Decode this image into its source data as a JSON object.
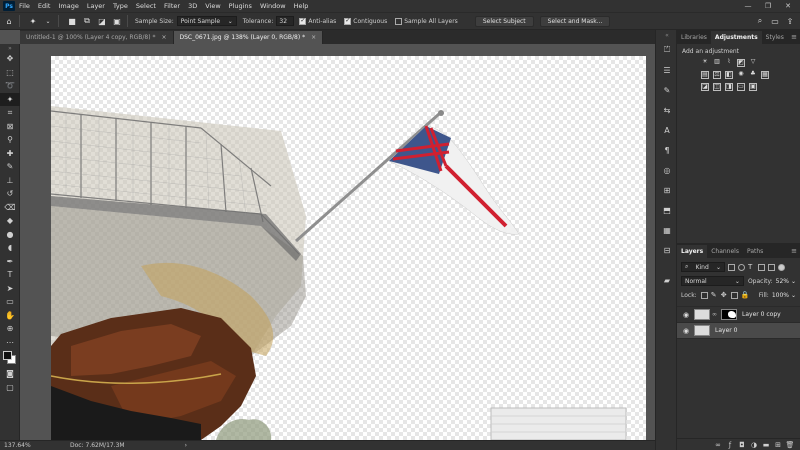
{
  "app": {
    "logo": "Ps"
  },
  "menu": [
    "File",
    "Edit",
    "Image",
    "Layer",
    "Type",
    "Select",
    "Filter",
    "3D",
    "View",
    "Plugins",
    "Window",
    "Help"
  ],
  "window_controls": {
    "minimize": "—",
    "maximize": "❐",
    "close": "✕"
  },
  "options": {
    "home_icon": "home-icon",
    "tool_icon": "magic-wand-icon",
    "sample_size_label": "Sample Size:",
    "sample_size_value": "Point Sample",
    "tolerance_label": "Tolerance:",
    "tolerance_value": "32",
    "anti_alias_label": "Anti-alias",
    "anti_alias_checked": true,
    "contiguous_label": "Contiguous",
    "contiguous_checked": true,
    "sample_all_label": "Sample All Layers",
    "sample_all_checked": false,
    "select_subject": "Select Subject",
    "select_and_mask": "Select and Mask..."
  },
  "tabs": [
    {
      "label": "Untitled-1 @ 100% (Layer 4 copy, RGB/8) *",
      "close": "×",
      "active": false
    },
    {
      "label": "DSC_0671.jpg @ 138% (Layer 0, RGB/8) *",
      "close": "×",
      "active": true
    }
  ],
  "status": {
    "zoom": "137.64%",
    "doc": "Doc: 7.62M/17.3M",
    "arrow": "›"
  },
  "panels": {
    "top_tabs": [
      "Libraries",
      "Adjustments",
      "Styles"
    ],
    "top_active": "Adjustments",
    "adjustments_title": "Add an adjustment",
    "layer_tabs": [
      "Layers",
      "Channels",
      "Paths"
    ],
    "layer_active": "Layers",
    "kind": "Kind",
    "blend_mode": "Normal",
    "opacity_label": "Opacity:",
    "opacity_value": "52%",
    "lock_label": "Lock:",
    "fill_label": "Fill:",
    "fill_value": "100%",
    "menu": "≡",
    "caret": "⌄",
    "layers": [
      {
        "name": "Layer 0 copy",
        "visible": true,
        "selected": false,
        "has_mask": true
      },
      {
        "name": "Layer 0",
        "visible": true,
        "selected": true,
        "has_mask": false
      }
    ]
  },
  "colors": {
    "accent": "#31a8ff",
    "bg": "#535353",
    "panel": "#323232"
  }
}
